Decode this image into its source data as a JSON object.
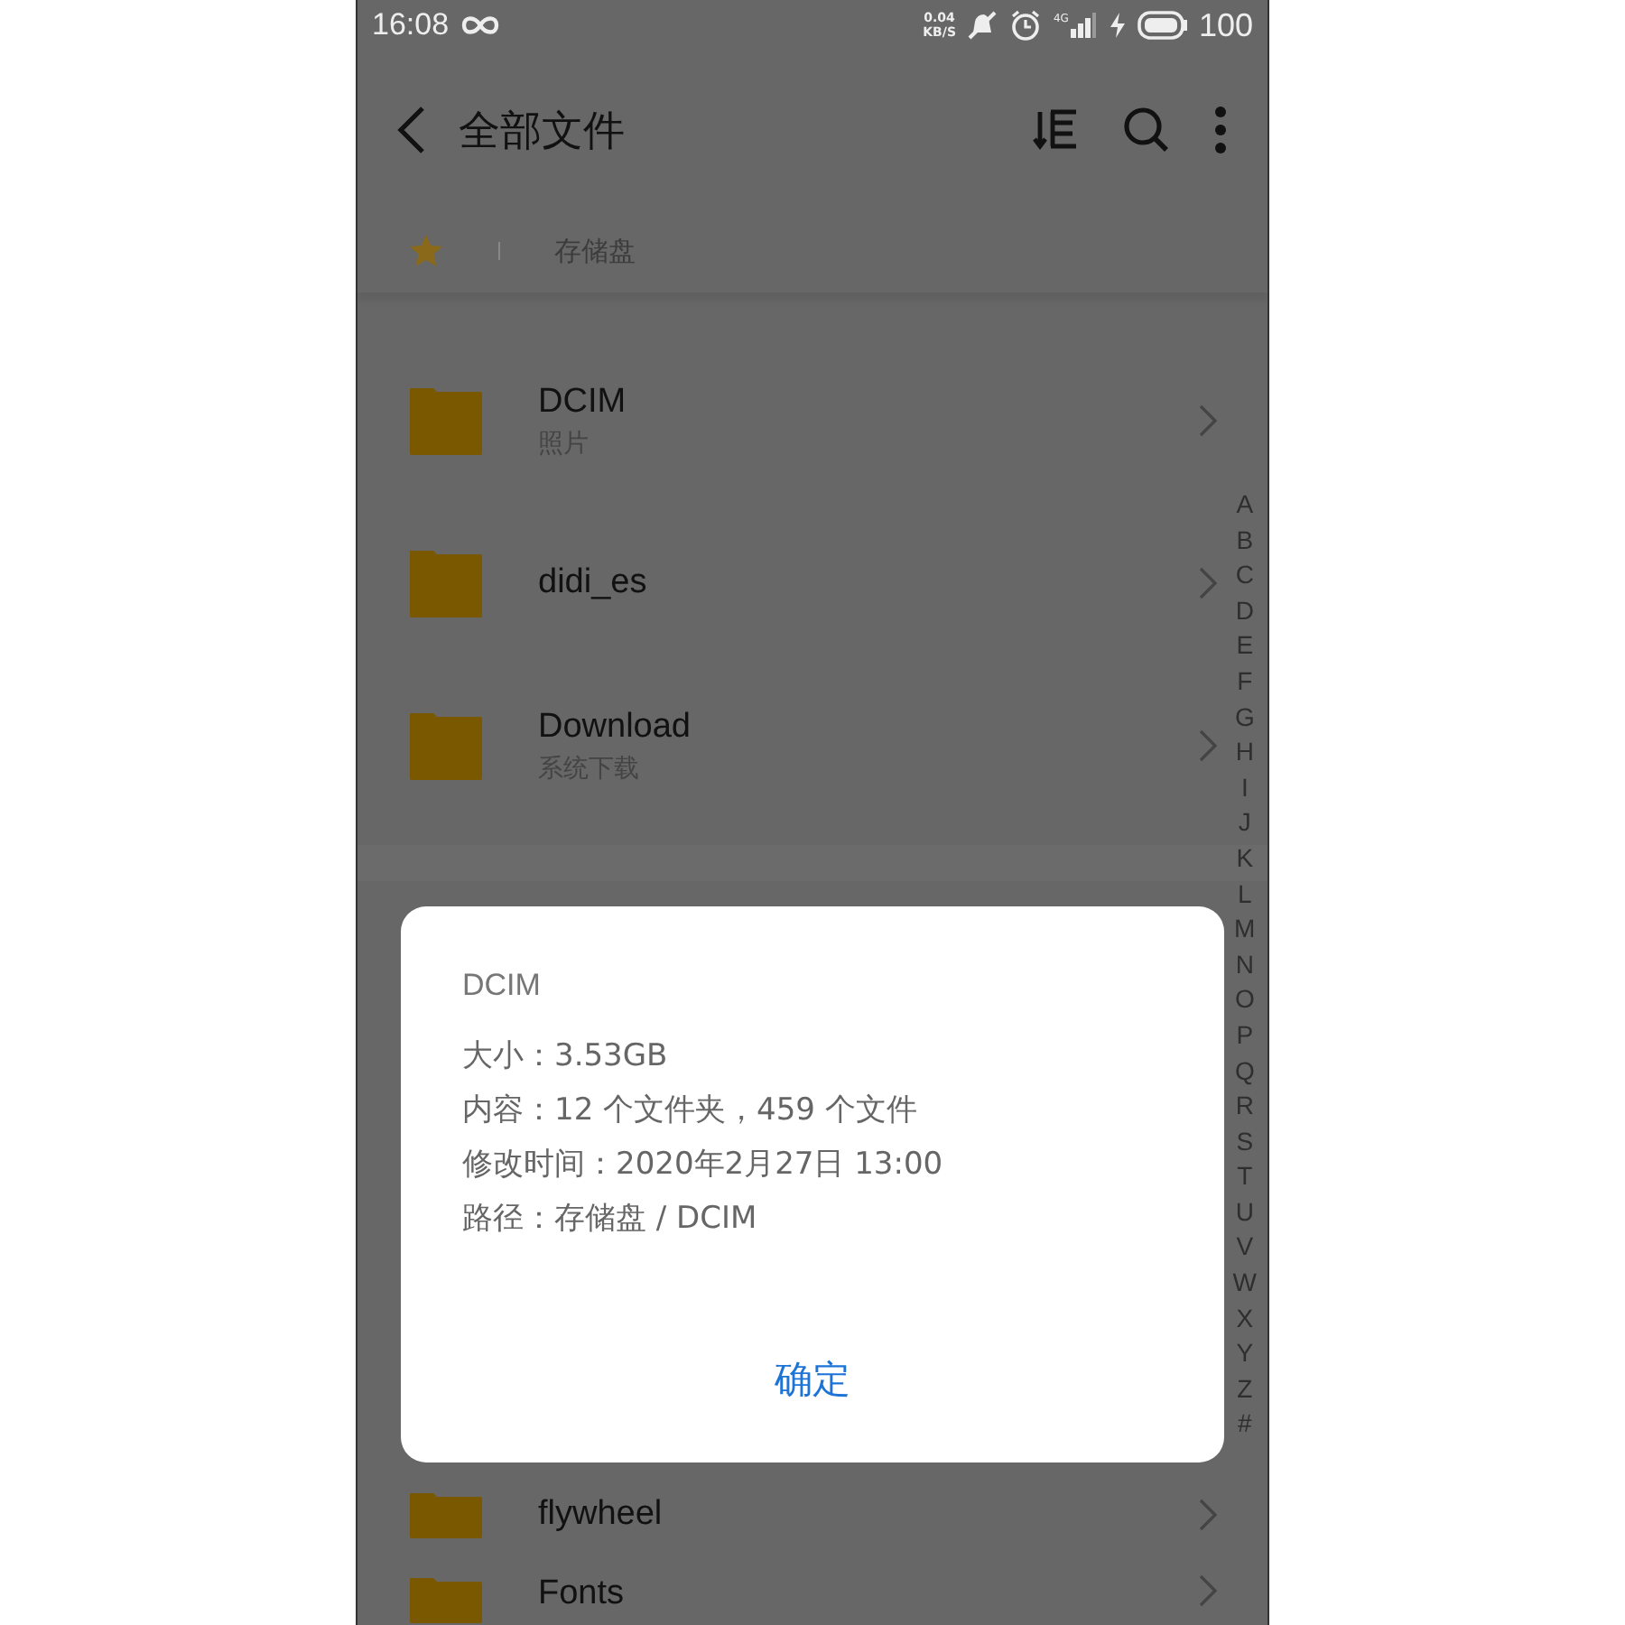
{
  "status_bar": {
    "time": "16:08",
    "speed": "0.04",
    "speed_unit": "KB/S",
    "network": "4G",
    "battery": "100"
  },
  "toolbar": {
    "title": "全部文件"
  },
  "breadcrumb": {
    "items": [
      "存储盘"
    ]
  },
  "folders": [
    {
      "name": "DCIM",
      "subtitle": "照片"
    },
    {
      "name": "didi_es"
    },
    {
      "name": "Download",
      "subtitle": "系统下载"
    }
  ],
  "folders_below": [
    {
      "name": "flywheel"
    },
    {
      "name": "Fonts"
    }
  ],
  "index_letters": [
    "A",
    "B",
    "C",
    "D",
    "E",
    "F",
    "G",
    "H",
    "I",
    "J",
    "K",
    "L",
    "M",
    "N",
    "O",
    "P",
    "Q",
    "R",
    "S",
    "T",
    "U",
    "V",
    "W",
    "X",
    "Y",
    "Z",
    "#"
  ],
  "dialog": {
    "title": "DCIM",
    "lines": [
      "大小：3.53GB",
      "内容：12 个文件夹，459 个文件",
      "修改时间：2020年2月27日 13:00",
      "路径：存储盘 / DCIM"
    ],
    "button": "确定"
  }
}
